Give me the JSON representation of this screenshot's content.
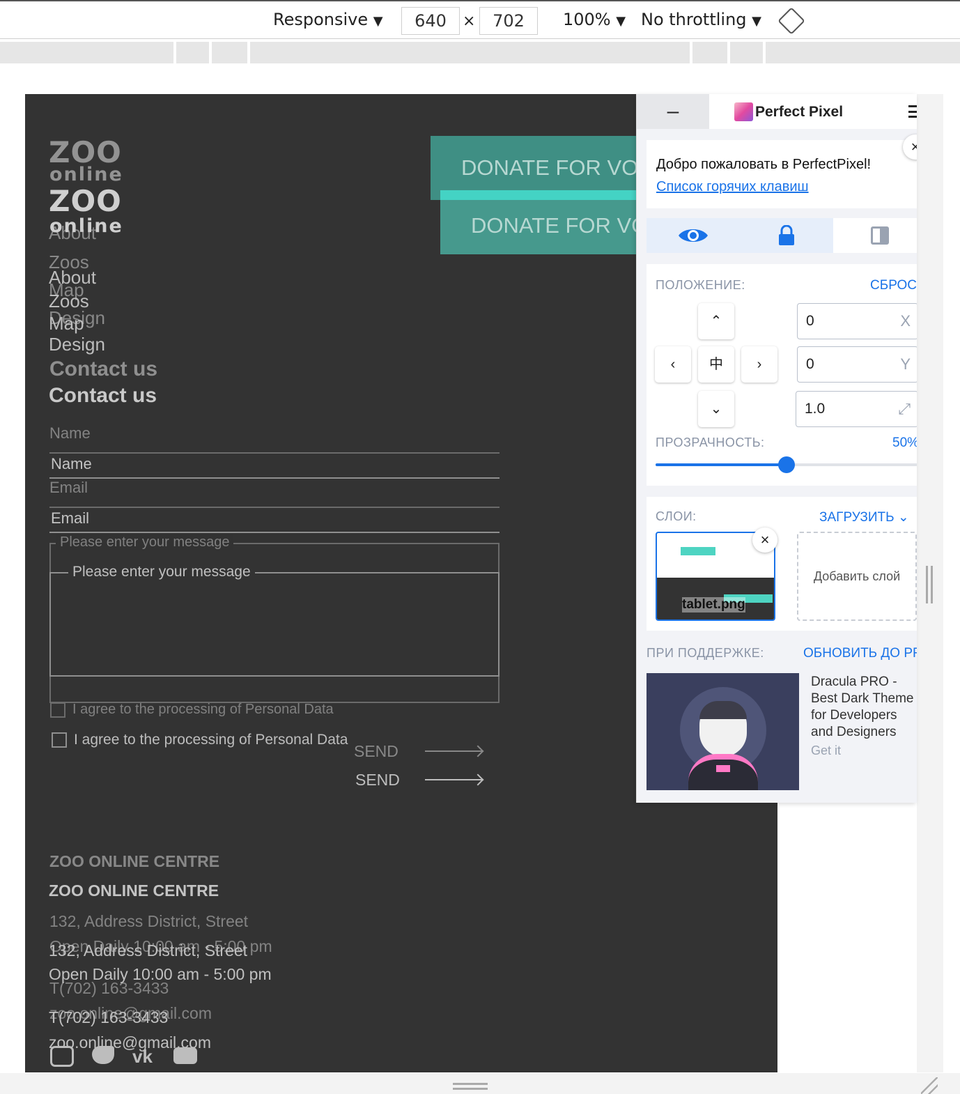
{
  "devtools": {
    "mode": "Responsive",
    "width": "640",
    "times": "×",
    "height": "702",
    "zoom": "100%",
    "throttling": "No throttling",
    "caret": "▼"
  },
  "page": {
    "logo": {
      "line1": "ZOO",
      "line2": "online"
    },
    "nav": [
      "About",
      "Zoos",
      "Map",
      "Design"
    ],
    "contact_heading": "Contact us",
    "form": {
      "name_placeholder": "Name",
      "email_placeholder": "Email",
      "message_placeholder": "Please enter your message",
      "agree_label": "I agree to the processing of Personal Data",
      "send_label": "SEND"
    },
    "donate_button": "DONATE FOR VOLUNTEERS",
    "footer": {
      "title": "ZOO ONLINE CENTRE",
      "address": "132, Address District, Street",
      "hours": "Open Daily 10:00 am - 5:00 pm",
      "phone": "T(702) 163-3433",
      "email": "zoo.online@gmail.com"
    },
    "socials": [
      "instagram-icon",
      "twitter-icon",
      "vk-icon",
      "youtube-icon"
    ]
  },
  "perfect_pixel": {
    "minimize": "–",
    "title": "Perfect Pixel",
    "close": "×",
    "welcome": "Добро пожаловать в PerfectPixel!",
    "hotkeys_link": "Список горячих клавиш",
    "position_label": "ПОЛОЖЕНИЕ:",
    "reset_label": "СБРОС",
    "x_value": "0",
    "x_suffix": "X",
    "y_value": "0",
    "y_suffix": "Y",
    "scale_value": "1.0",
    "nudge": {
      "up": "⌃",
      "left": "‹",
      "center": "中",
      "right": "›",
      "down": "⌄"
    },
    "opacity_label": "ПРОЗРАЧНОСТЬ:",
    "opacity_value": "50%",
    "opacity": 0.5,
    "layers_label": "СЛОИ:",
    "upload_label": "ЗАГРУЗИТЬ",
    "layer_name": "tablet.png",
    "add_layer_label": "Добавить слой",
    "sponsor_label": "ПРИ ПОДДЕРЖКЕ:",
    "upgrade_label": "ОБНОВИТЬ ДО PRO",
    "ad_text": "Dracula PRO - Best Dark Theme for Developers and Designers",
    "ad_link": "Get it"
  },
  "colors": {
    "page_bg": "#333333",
    "accent_teal": "#3f8f84",
    "pp_blue": "#1a73e8"
  }
}
